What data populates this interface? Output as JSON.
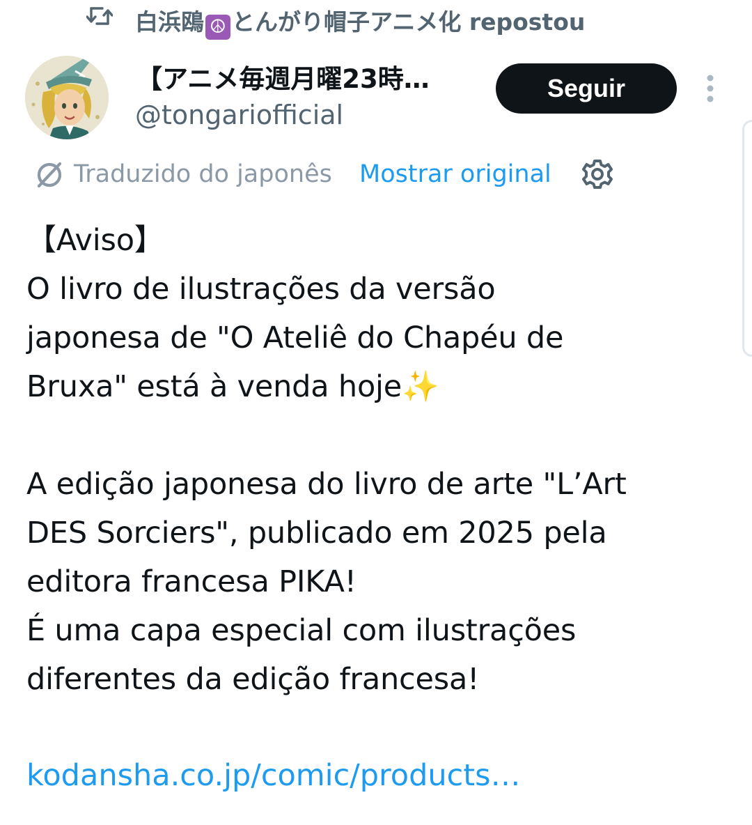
{
  "repost": {
    "reposter_name_before": "白浜鴎",
    "reposter_emoji": "☮",
    "reposter_name_after": "とんがり帽子アニメ化",
    "action": " repostou"
  },
  "author": {
    "display_name": "【アニメ毎週月曜23時…",
    "handle": "@tongariofficial"
  },
  "follow_button_label": "Seguir",
  "translation": {
    "label": "Traduzido do japonês",
    "show_original": "Mostrar original"
  },
  "tweet": {
    "lines": [
      "【Aviso】",
      "O livro de ilustrações da versão",
      "japonesa de \"O Ateliê do Chapéu de",
      "Bruxa\" está à venda hoje",
      "",
      "A edição japonesa do livro de arte \"L’Art",
      "DES Sorciers\", publicado em 2025 pela",
      "editora francesa PIKA!",
      "É uma capa especial com ilustrações",
      "diferentes da edição francesa!"
    ],
    "sparkle_emoji": "✨",
    "link": "kodansha.co.jp/comic/products…"
  },
  "icons": {
    "repost": "repost-icon",
    "more": "more-vertical-icon",
    "translate": "translate-icon",
    "settings": "gear-icon"
  },
  "colors": {
    "text_primary": "#0f1419",
    "text_secondary": "#536471",
    "link": "#1d9bf0",
    "follow_button_bg": "#0f1419",
    "follow_button_text": "#ffffff"
  }
}
